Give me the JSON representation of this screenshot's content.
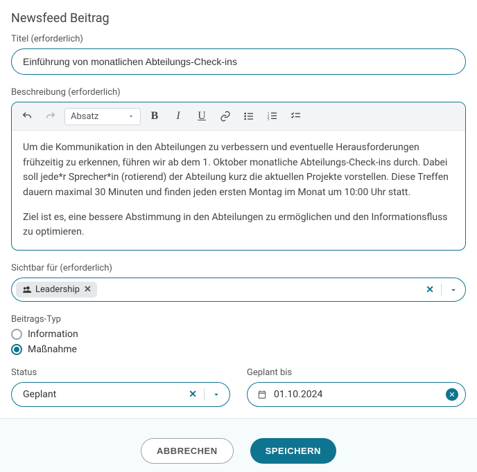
{
  "form_title": "Newsfeed Beitrag",
  "title": {
    "label": "Titel (erforderlich)",
    "value": "Einführung von monatlichen Abteilungs-Check-ins"
  },
  "description": {
    "label": "Beschreibung (erforderlich)",
    "style_select": "Absatz",
    "paragraphs": [
      "Um die Kommunikation in den Abteilungen zu verbessern und eventuelle Herausforderungen frühzeitig zu erkennen, führen wir ab dem 1. Oktober monatliche Abteilungs-Check-ins durch. Dabei soll jede*r Sprecher*in (rotierend) der Abteilung kurz die aktuellen Projekte vorstellen. Diese Treffen dauern maximal 30 Minuten und finden jeden ersten Montag im Monat um 10:00 Uhr statt.",
      "Ziel ist es, eine bessere Abstimmung in den Abteilungen zu ermöglichen und den Informationsfluss zu optimieren."
    ]
  },
  "visibility": {
    "label": "Sichtbar für (erforderlich)",
    "chip": "Leadership"
  },
  "post_type": {
    "label": "Beitrags-Typ",
    "options": [
      "Information",
      "Maßnahme"
    ],
    "selected_index": 1
  },
  "status": {
    "label": "Status",
    "value": "Geplant"
  },
  "planned_until": {
    "label": "Geplant bis",
    "value": "01.10.2024"
  },
  "buttons": {
    "cancel": "ABBRECHEN",
    "save": "SPEICHERN"
  }
}
